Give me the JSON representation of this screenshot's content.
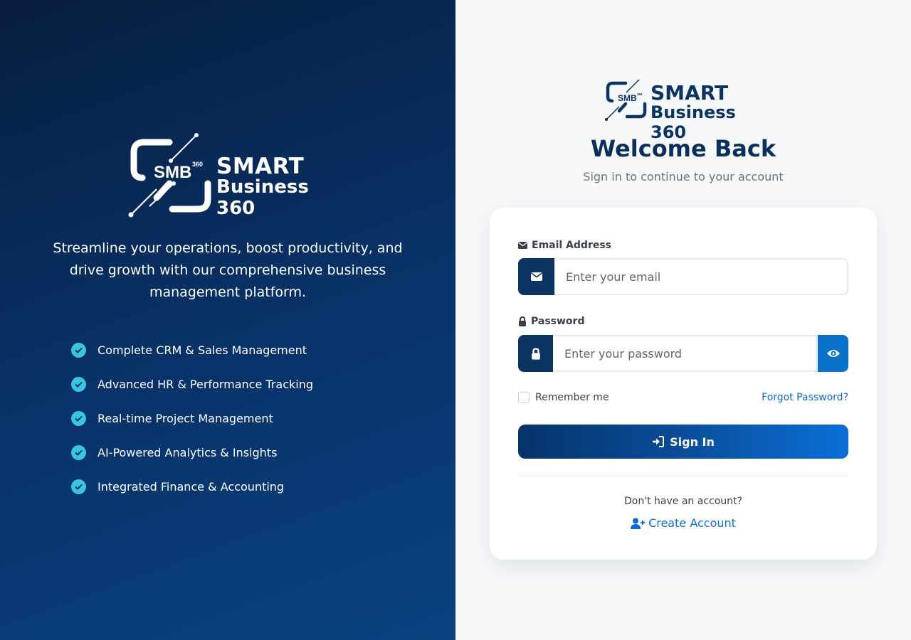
{
  "brand": {
    "mark_text": "SMB",
    "mark_superscript": "360",
    "word1": "SMART",
    "word2": "Business 360"
  },
  "left": {
    "tagline": "Streamline your operations, boost productivity, and drive growth with our comprehensive business management platform.",
    "features": [
      {
        "label": "Complete CRM & Sales Management",
        "icon": "check-circle-icon"
      },
      {
        "label": "Advanced HR & Performance Tracking",
        "icon": "check-circle-icon"
      },
      {
        "label": "Real-time Project Management",
        "icon": "check-circle-icon"
      },
      {
        "label": "AI-Powered Analytics & Insights",
        "icon": "check-circle-icon"
      },
      {
        "label": "Integrated Finance & Accounting",
        "icon": "check-circle-icon"
      }
    ]
  },
  "login": {
    "title": "Welcome Back",
    "subtitle": "Sign in to continue to your account",
    "email_label": "Email Address",
    "email_placeholder": "Enter your email",
    "email_value": "",
    "password_label": "Password",
    "password_placeholder": "Enter your password",
    "password_value": "",
    "remember_label": "Remember me",
    "remember_checked": false,
    "forgot_label": "Forgot Password?",
    "signin_label": "Sign In",
    "no_account_text": "Don't have an account?",
    "create_label": "Create Account"
  },
  "colors": {
    "navy": "#0b3463",
    "accent_blue": "#0a6fd1",
    "check_teal": "#39c6de"
  }
}
